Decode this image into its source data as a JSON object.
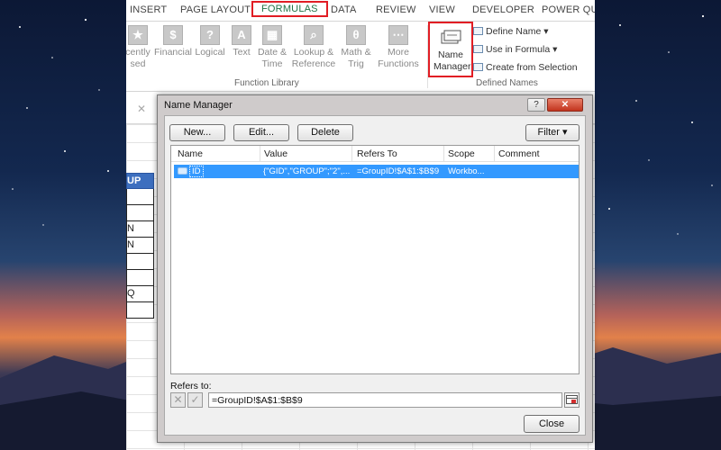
{
  "ribbon": {
    "tabs": [
      {
        "label": "INSERT",
        "active": false
      },
      {
        "label": "PAGE LAYOUT",
        "active": false
      },
      {
        "label": "FORMULAS",
        "active": true
      },
      {
        "label": "DATA",
        "active": false
      },
      {
        "label": "REVIEW",
        "active": false
      },
      {
        "label": "VIEW",
        "active": false
      },
      {
        "label": "DEVELOPER",
        "active": false
      },
      {
        "label": "POWER QUE",
        "active": false
      }
    ],
    "function_library": {
      "recently_used": [
        "cently",
        "sed"
      ],
      "financial": "Financial",
      "logical": "Logical",
      "text": "Text",
      "date_time": [
        "Date &",
        "Time"
      ],
      "lookup_reference": [
        "Lookup &",
        "Reference"
      ],
      "math_trig": [
        "Math &",
        "Trig"
      ],
      "more_functions": [
        "More",
        "Functions"
      ],
      "group_label": "Function Library"
    },
    "defined_names": {
      "name_manager": [
        "Name",
        "Manager"
      ],
      "define_name": "Define Name",
      "use_in_formula": "Use in Formula",
      "create_from_selection": "Create from Selection",
      "group_label": "Defined Names"
    }
  },
  "sheet": {
    "formula_bar_icon": "✕",
    "column_a_cells": [
      "UP",
      "",
      "",
      "N",
      "N",
      "",
      "",
      "Q",
      ""
    ]
  },
  "dialog": {
    "title": "Name Manager",
    "help_label": "?",
    "close_label": "✕",
    "toolbar": {
      "new_label": "New...",
      "edit_label": "Edit...",
      "delete_label": "Delete",
      "filter_label": "Filter"
    },
    "columns": [
      "Name",
      "Value",
      "Refers To",
      "Scope",
      "Comment"
    ],
    "rows": [
      {
        "name": "ID",
        "value": "{\"GID\",\"GROUP\";\"2\",...",
        "refers_to": "=GroupID!$A$1:$B$9",
        "scope": "Workbo...",
        "comment": "",
        "selected": true
      }
    ],
    "refers_to_label": "Refers to:",
    "refers_to_value": "=GroupID!$A$1:$B$9",
    "cancel_icon": "✕",
    "confirm_icon": "✓",
    "close_button_label": "Close"
  },
  "colors": {
    "formulas_tab_text": "#217346",
    "highlight_border": "#e11d24",
    "selection_blue": "#3399ff",
    "header_cell_blue": "#3d6fbf"
  }
}
